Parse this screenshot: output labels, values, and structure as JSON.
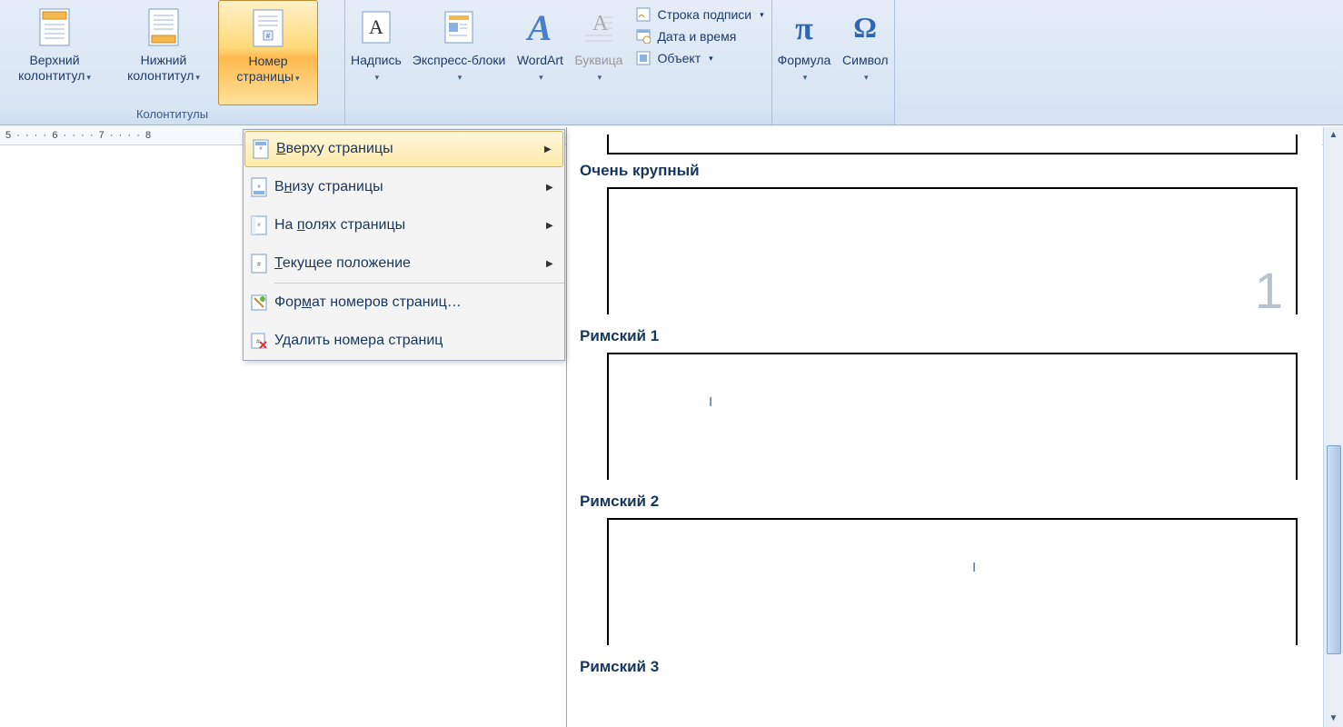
{
  "ribbon": {
    "group_headers": {
      "label": "Колонтитулы"
    },
    "header_btn": {
      "line1": "Верхний",
      "line2": "колонтитул"
    },
    "footer_btn": {
      "line1": "Нижний",
      "line2": "колонтитул"
    },
    "page_num_btn": {
      "line1": "Номер",
      "line2": "страницы"
    },
    "textbox_btn": "Надпись",
    "quick_parts_btn": "Экспресс-блоки",
    "wordart_btn": "WordArt",
    "dropcap_btn": "Буквица",
    "signature_line": "Строка подписи",
    "date_time": "Дата и время",
    "object": "Объект",
    "formula_btn": "Формула",
    "symbol_btn": "Символ"
  },
  "ruler_text": "5  ·  ·  ·  ·  6  ·  ·  ·  ·  7  ·  ·  ·  ·  8",
  "menu": {
    "top_of_page": "Вверху страницы",
    "bottom_of_page": "Внизу страницы",
    "page_margins": "На полях страницы",
    "current_position": "Текущее положение",
    "format_numbers": "Формат номеров страниц…",
    "remove_numbers": "Удалить номера страниц"
  },
  "gallery": {
    "very_large": "Очень крупный",
    "roman1": "Римский 1",
    "roman2": "Римский 2",
    "roman3": "Римский 3",
    "big_number": "1",
    "roman_char": "I"
  }
}
